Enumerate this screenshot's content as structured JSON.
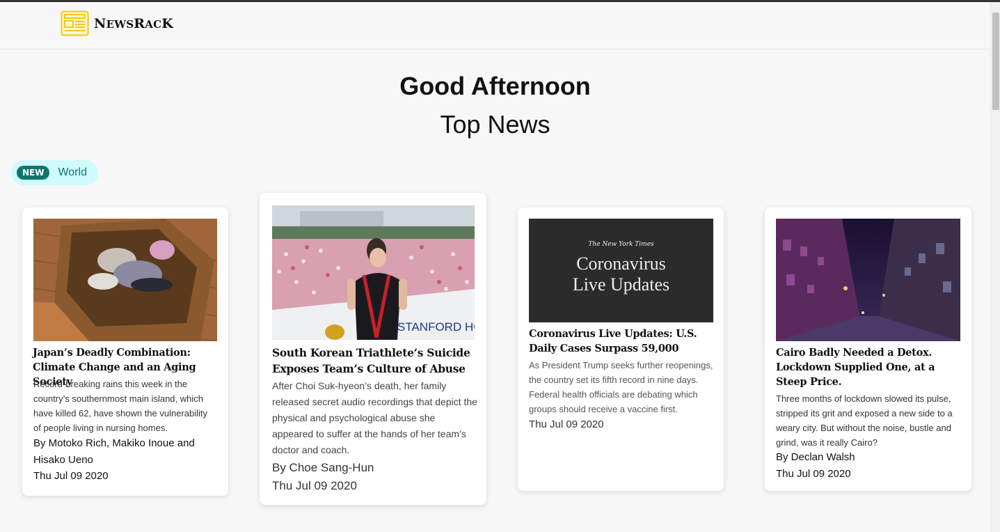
{
  "brand": {
    "name_first": "N",
    "name_sc1": "EWS",
    "name_mid": "R",
    "name_sc2": "AC",
    "name_last": "K",
    "logo_icon": "newspaper-icon",
    "accent": "#f5c518"
  },
  "greeting": "Good Afternoon",
  "section_title": "Top News",
  "category_chip": {
    "badge": "NEW",
    "label": "World",
    "badge_color": "#0f766e",
    "bg_color": "#cffafe"
  },
  "articles": [
    {
      "title": "Japan’s Deadly Combination: Climate Change and an Aging Society",
      "description": "Record-breaking rains this week in the country’s southernmost main island, which have killed 62, have shown the vulnerability of people living in nursing homes.",
      "author": "By Motoko Rich, Makiko Inoue and Hisako Ueno",
      "date": "Thu Jul 09 2020"
    },
    {
      "title": "South Korean Triathlete’s Suicide Exposes Team’s Culture of Abuse",
      "description": "After Choi Suk-hyeon’s death, her family released secret audio recordings that depict the physical and psychological abuse she appeared to suffer at the hands of her team’s doctor and coach.",
      "author": "By Choe Sang-Hun",
      "date": "Thu Jul 09 2020",
      "image_text": "STANFORD HOT"
    },
    {
      "title": "Coronavirus Live Updates: U.S. Daily Cases Surpass 59,000",
      "description": "As President Trump seeks further reopenings, the country set its fifth record in nine days. Federal health officials are debating which groups should receive a vaccine first.",
      "author": "",
      "date": "Thu Jul 09 2020",
      "image_masthead": "The New York Times",
      "image_line1": "Coronavirus",
      "image_line2": "Live Updates"
    },
    {
      "title": "Cairo Badly Needed a Detox. Lockdown Supplied One, at a Steep Price.",
      "description": "Three months of lockdown slowed its pulse, stripped its grit and exposed a new side to a weary city. But without the noise, bustle and grind, was it really Cairo?",
      "author": "By Declan Walsh",
      "date": "Thu Jul 09 2020"
    }
  ]
}
